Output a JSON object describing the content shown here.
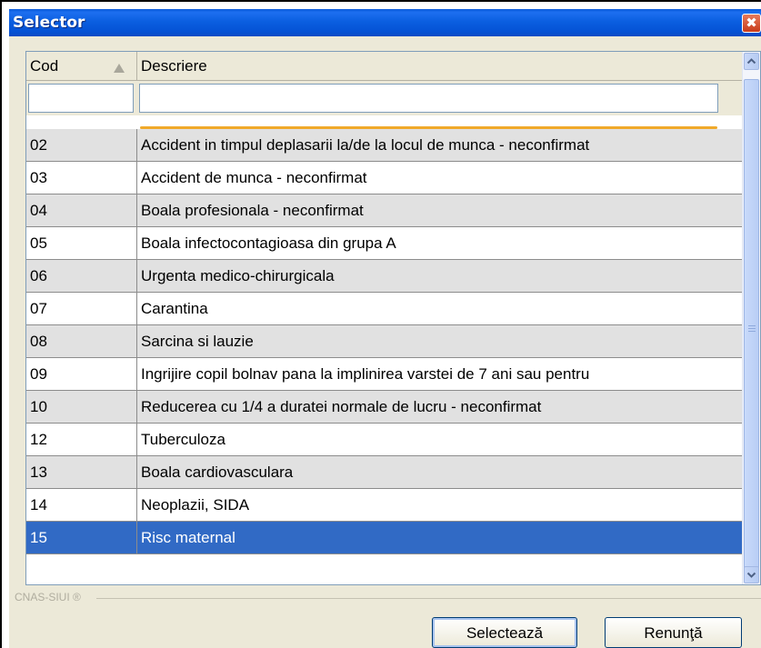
{
  "window": {
    "title": "Selector",
    "close_label": "✖"
  },
  "grid": {
    "columns": [
      {
        "label": "Cod",
        "sorted": "ascending"
      },
      {
        "label": "Descriere"
      }
    ],
    "filter": {
      "cod_value": "",
      "descriere_value": ""
    },
    "rows": [
      {
        "cod": "02",
        "descriere": "Accident in timpul deplasarii la/de la locul de munca - neconfirmat"
      },
      {
        "cod": "03",
        "descriere": "Accident de munca - neconfirmat"
      },
      {
        "cod": "04",
        "descriere": "Boala profesionala - neconfirmat"
      },
      {
        "cod": "05",
        "descriere": "Boala infectocontagioasa din grupa A"
      },
      {
        "cod": "06",
        "descriere": "Urgenta medico-chirurgicala"
      },
      {
        "cod": "07",
        "descriere": "Carantina"
      },
      {
        "cod": "08",
        "descriere": "Sarcina si lauzie"
      },
      {
        "cod": "09",
        "descriere": "Ingrijire copil bolnav pana la implinirea varstei de 7 ani sau pentru"
      },
      {
        "cod": "10",
        "descriere": "Reducerea cu 1/4 a duratei normale de lucru - neconfirmat"
      },
      {
        "cod": "12",
        "descriere": "Tuberculoza"
      },
      {
        "cod": "13",
        "descriere": "Boala cardiovasculara"
      },
      {
        "cod": "14",
        "descriere": "Neoplazii, SIDA"
      },
      {
        "cod": "15",
        "descriere": "Risc maternal"
      }
    ],
    "selected_cod": "15"
  },
  "footer": {
    "brand": "CNAS-SIUI ®",
    "select_label": "Selectează",
    "cancel_label": "Renunţă"
  },
  "colors": {
    "title_bar": "#0553d6",
    "selection": "#316ac5",
    "row_alt": "#e1e1e1",
    "filter_accent": "#f0a92a"
  }
}
